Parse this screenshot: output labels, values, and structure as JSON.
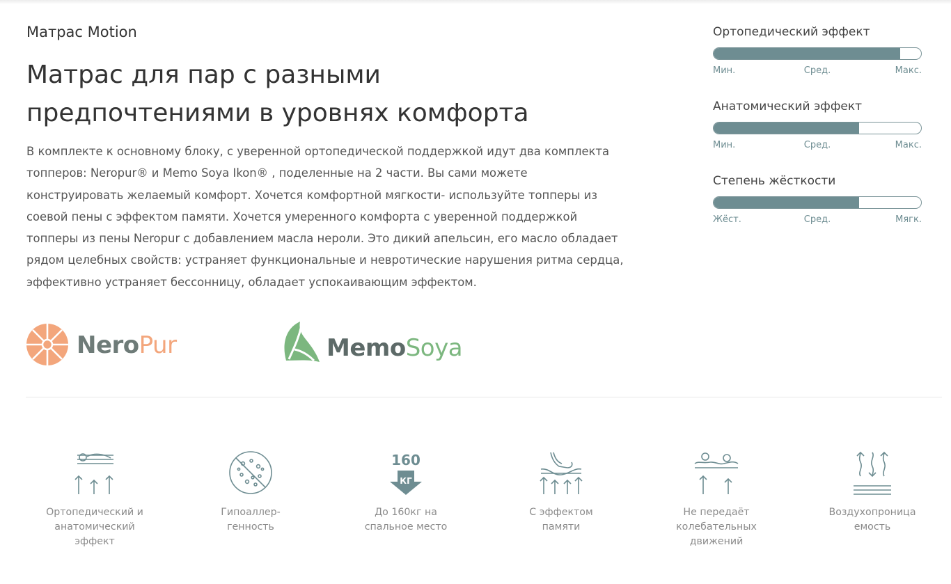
{
  "product": {
    "subtitle": "Матрас Motion",
    "headline_line1": "Матрас для пар с разными",
    "headline_line2": "предпочтениями в уровнях комфорта",
    "description": "В комплекте к основному блоку, с уверенной ортопедической поддержкой идут два комплекта топперов: Neropur®  и Memo Soya Ikon® , поделенные на 2 части. Вы сами можете конструировать желаемый комфорт. Хочется комфортной мягкости- используйте топперы из соевой пены с эффектом памяти. Хочется умеренного комфорта с уверенной поддержкой топперы из пены Neropur с добавлением масла нероли. Это дикий апельсин, его масло обладает рядом целебных свойств: устраняет функциональные и невротические нарушения ритма сердца, эффективно устраняет бессонницу, обладает успокаивающим эффектом."
  },
  "logos": {
    "neropur": {
      "part1": "Nero",
      "part2": "Pur",
      "color1": "#6e7b78",
      "color2": "#f3a67c",
      "icon": "orange-slice-icon"
    },
    "memosoya": {
      "part1": "Memo",
      "part2": "Soya",
      "color1": "#5d6a68",
      "color2": "#7cb77f",
      "icon": "leaf-icon"
    }
  },
  "meters": [
    {
      "title": "Ортопедический эффект",
      "min": "Мин.",
      "mid": "Сред.",
      "max": "Макс.",
      "level": 0.9
    },
    {
      "title": "Анатомический эффект",
      "min": "Мин.",
      "mid": "Сред.",
      "max": "Макс.",
      "level": 0.7
    },
    {
      "title": "Степень жёсткости",
      "min": "Жёст.",
      "mid": "Сред.",
      "max": "Мягк.",
      "level": 0.7
    }
  ],
  "features": [
    {
      "icon": "orthopedic-support-icon",
      "line1": "Ортопедический и",
      "line2": "анатомический",
      "line3": "эффект"
    },
    {
      "icon": "hypoallergenic-icon",
      "line1": "Гипоаллер-",
      "line2": "генность",
      "line3": ""
    },
    {
      "icon": "weight-limit-icon",
      "weight_number": "160",
      "weight_unit": "КГ",
      "line1": "До 160кг на",
      "line2": "спальное место",
      "line3": ""
    },
    {
      "icon": "memory-effect-icon",
      "line1": "С эффектом",
      "line2": "памяти",
      "line3": ""
    },
    {
      "icon": "no-motion-transfer-icon",
      "line1": "Не передаёт",
      "line2": "колебательных",
      "line3": "движений"
    },
    {
      "icon": "breathability-icon",
      "line1": "Воздухопроница",
      "line2": "емость",
      "line3": ""
    }
  ],
  "colors": {
    "accent": "#6e8d92",
    "text": "#333333",
    "muted": "#8b8b8b"
  }
}
